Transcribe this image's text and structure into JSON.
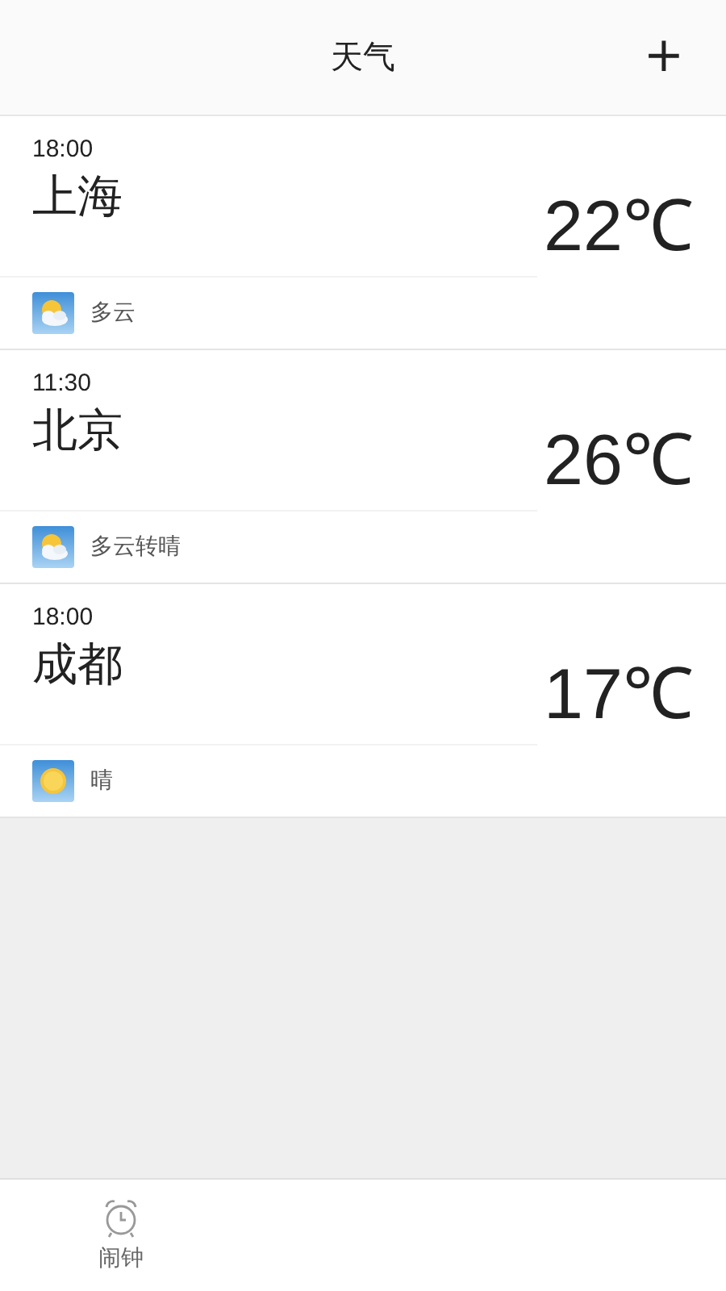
{
  "header": {
    "title": "天气",
    "add_button": "+"
  },
  "cities": [
    {
      "time": "18:00",
      "name": "上海",
      "temperature": "22℃",
      "condition": "多云",
      "kind": "cloudy"
    },
    {
      "time": "11:30",
      "name": "北京",
      "temperature": "26℃",
      "condition": "多云转晴",
      "kind": "cloudy"
    },
    {
      "time": "18:00",
      "name": "成都",
      "temperature": "17℃",
      "condition": "晴",
      "kind": "sunny"
    }
  ],
  "bottom_nav": [
    {
      "label": "闹钟"
    }
  ]
}
